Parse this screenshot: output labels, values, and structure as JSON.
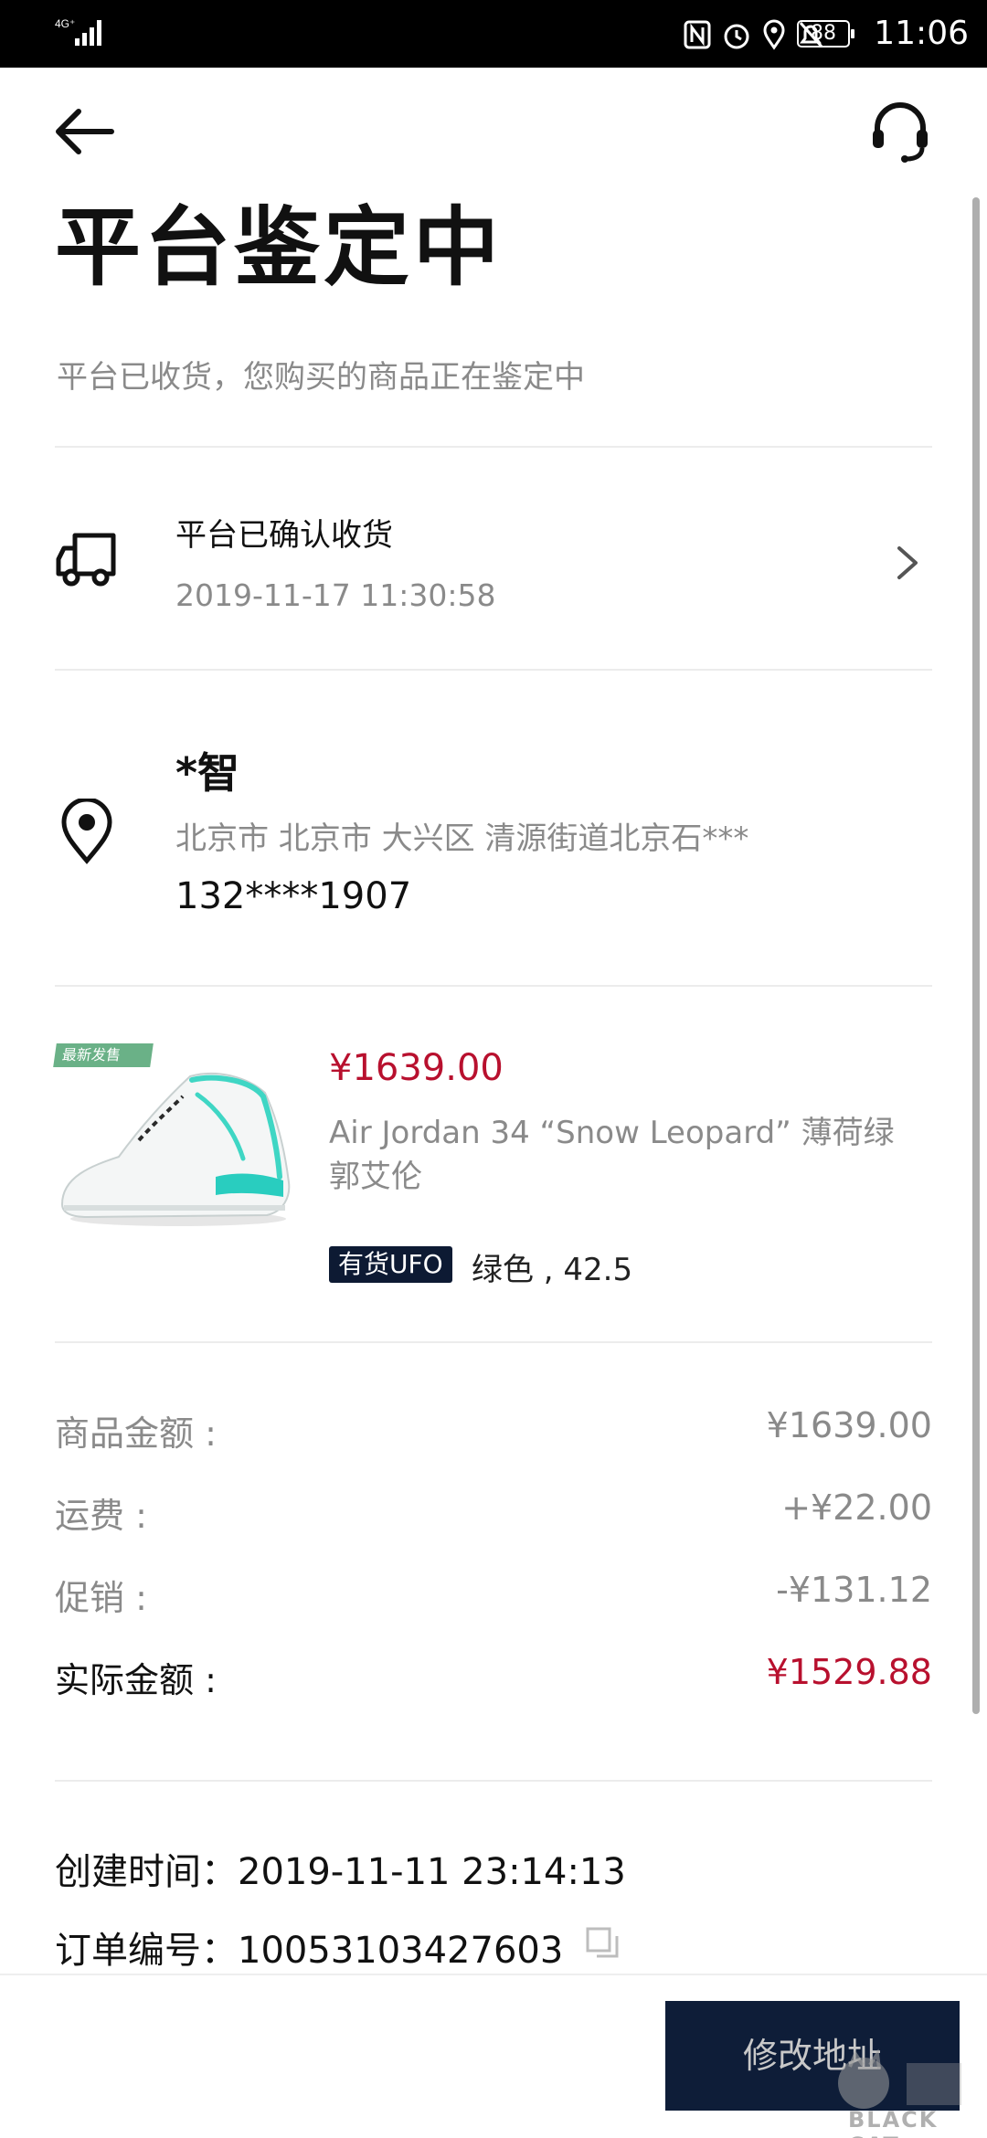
{
  "status_bar": {
    "network": "4G⁺",
    "battery": "88",
    "time": "11:06"
  },
  "header": {
    "title": "平台鉴定中",
    "subtitle": "平台已收货，您购买的商品正在鉴定中"
  },
  "delivery": {
    "status": "平台已确认收货",
    "time": "2019-11-17 11:30:58"
  },
  "address": {
    "name": "*智",
    "detail": "北京市 北京市 大兴区 清源街道北京石***",
    "phone": "132****1907"
  },
  "product": {
    "tag": "最新发售",
    "price": "¥1639.00",
    "title": "Air Jordan 34 “Snow Leopard” 薄荷绿 郭艾伦",
    "stock_badge": "有货UFO",
    "spec": "绿色 , 42.5"
  },
  "summary": {
    "rows": [
      {
        "label": "商品金额 :",
        "value": "¥1639.00"
      },
      {
        "label": "运费 :",
        "value": "+¥22.00"
      },
      {
        "label": "促销 :",
        "value": "-¥131.12"
      },
      {
        "label": "实际金额 :",
        "value": "¥1529.88"
      }
    ]
  },
  "order_meta": {
    "created_label": "创建时间：",
    "created_value": "2019-11-11 23:14:13",
    "order_label": "订单编号：",
    "order_value": "10053103427603"
  },
  "actions": {
    "edit_address": "修改地址"
  },
  "watermark": {
    "text": "BLACK CAT"
  },
  "colors": {
    "accent_red": "#b8102e",
    "button_navy": "#0e1d38",
    "muted_gray": "#8a8a8a"
  }
}
